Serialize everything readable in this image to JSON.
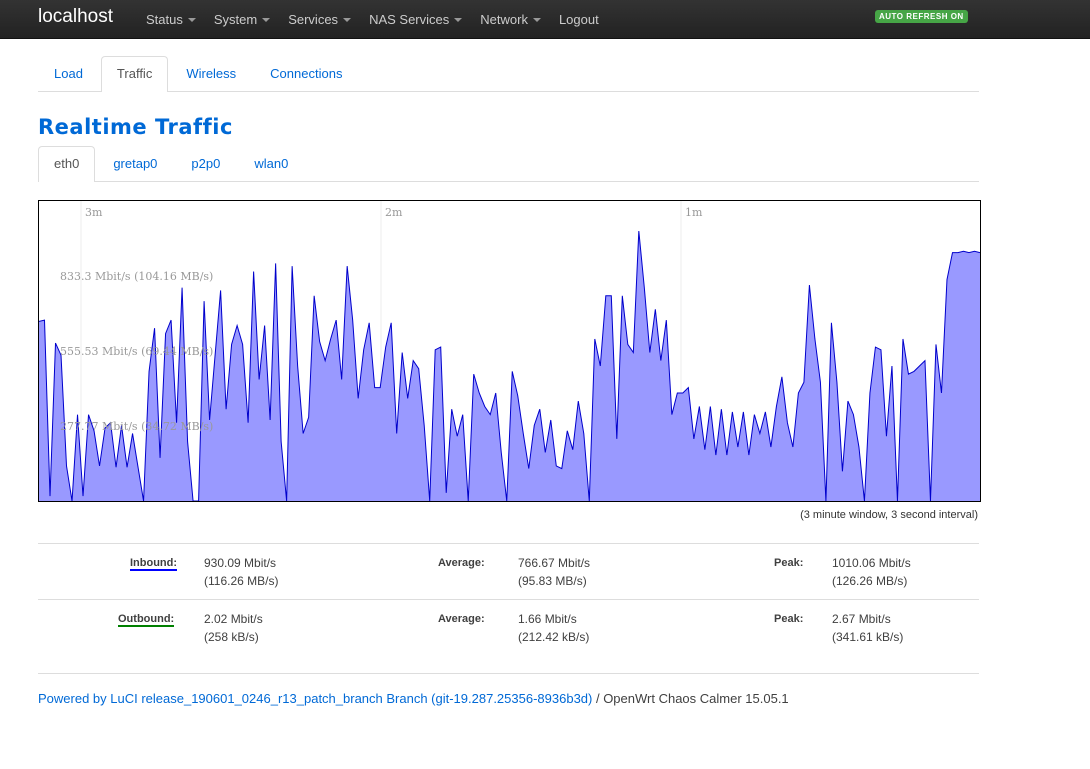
{
  "navbar": {
    "brand": "localhost",
    "menu": [
      {
        "label": "Status",
        "dropdown": true
      },
      {
        "label": "System",
        "dropdown": true
      },
      {
        "label": "Services",
        "dropdown": true
      },
      {
        "label": "NAS Services",
        "dropdown": true
      },
      {
        "label": "Network",
        "dropdown": true
      },
      {
        "label": "Logout",
        "dropdown": false
      }
    ],
    "auto_refresh": "AUTO REFRESH ON"
  },
  "main_tabs": [
    {
      "label": "Load",
      "active": false
    },
    {
      "label": "Traffic",
      "active": true
    },
    {
      "label": "Wireless",
      "active": false
    },
    {
      "label": "Connections",
      "active": false
    }
  ],
  "page_title": "Realtime Traffic",
  "interface_tabs": [
    {
      "label": "eth0",
      "active": true
    },
    {
      "label": "gretap0",
      "active": false
    },
    {
      "label": "p2p0",
      "active": false
    },
    {
      "label": "wlan0",
      "active": false
    }
  ],
  "chart_data": {
    "type": "area",
    "x_labels": [
      "3m",
      "2m",
      "1m"
    ],
    "y_labels": [
      "833.3 Mbit/s (104.16 MB/s)",
      "555.53 Mbit/s (69.44 MB/s)",
      "277.77 Mbit/s (34.72 MB/s)"
    ],
    "y_label_values": [
      833.3,
      555.53,
      277.77
    ],
    "ylim": [
      0,
      1111.1
    ],
    "unit": "Mbit/s",
    "fill_color": "#9999ff",
    "line_color": "#0000cc",
    "values": [
      665,
      670,
      18,
      585,
      540,
      130,
      0,
      320,
      18,
      320,
      260,
      130,
      270,
      290,
      125,
      280,
      125,
      250,
      125,
      0,
      480,
      640,
      160,
      620,
      670,
      290,
      790,
      220,
      0,
      0,
      740,
      300,
      540,
      780,
      340,
      580,
      650,
      580,
      290,
      850,
      450,
      650,
      300,
      880,
      220,
      0,
      870,
      500,
      250,
      310,
      760,
      590,
      520,
      600,
      670,
      450,
      870,
      670,
      380,
      560,
      660,
      420,
      420,
      570,
      660,
      250,
      550,
      380,
      520,
      490,
      280,
      0,
      560,
      570,
      30,
      340,
      240,
      320,
      0,
      470,
      400,
      350,
      320,
      400,
      180,
      0,
      480,
      390,
      250,
      120,
      280,
      340,
      180,
      300,
      130,
      120,
      260,
      190,
      370,
      250,
      0,
      600,
      500,
      760,
      760,
      230,
      760,
      580,
      550,
      1000,
      790,
      550,
      710,
      520,
      670,
      320,
      400,
      400,
      420,
      230,
      350,
      190,
      350,
      170,
      340,
      170,
      330,
      200,
      330,
      170,
      320,
      250,
      330,
      200,
      350,
      460,
      290,
      200,
      400,
      440,
      800,
      600,
      440,
      0,
      660,
      440,
      110,
      370,
      320,
      200,
      0,
      400,
      570,
      560,
      240,
      500,
      0,
      600,
      470,
      480,
      500,
      520,
      0,
      580,
      400,
      820,
      920,
      920,
      925,
      920,
      925,
      920
    ],
    "note": "(3 minute window, 3 second interval)"
  },
  "stats": {
    "inbound": {
      "label": "Inbound:",
      "current": "930.09 Mbit/s",
      "current_bytes": "(116.26 MB/s)",
      "avg_label": "Average:",
      "average": "766.67 Mbit/s",
      "average_bytes": "(95.83 MB/s)",
      "peak_label": "Peak:",
      "peak": "1010.06 Mbit/s",
      "peak_bytes": "(126.26 MB/s)"
    },
    "outbound": {
      "label": "Outbound:",
      "current": "2.02 Mbit/s",
      "current_bytes": "(258 kB/s)",
      "avg_label": "Average:",
      "average": "1.66 Mbit/s",
      "average_bytes": "(212.42 kB/s)",
      "peak_label": "Peak:",
      "peak": "2.67 Mbit/s",
      "peak_bytes": "(341.61 kB/s)"
    }
  },
  "footer": {
    "link": "Powered by LuCI release_190601_0246_r13_patch_branch Branch (git-19.287.25356-8936b3d)",
    "suffix": " / OpenWrt Chaos Calmer 15.05.1"
  }
}
